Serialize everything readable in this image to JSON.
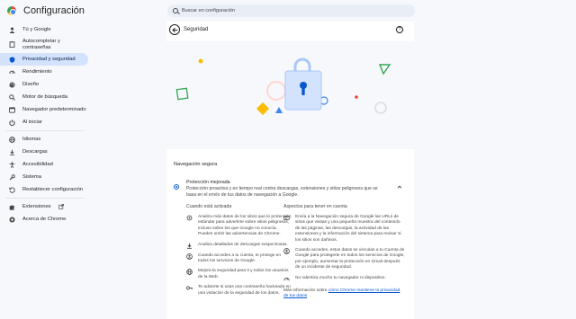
{
  "app": {
    "title": "Configuración"
  },
  "search": {
    "placeholder": "Buscar en configuración"
  },
  "sidebar": {
    "items": [
      {
        "label": "Tú y Google",
        "icon": "person-icon"
      },
      {
        "label": "Autocompletar y contraseñas",
        "icon": "clipboard-icon"
      },
      {
        "label": "Privacidad y seguridad",
        "icon": "shield-icon",
        "active": true
      },
      {
        "label": "Rendimiento",
        "icon": "speedometer-icon"
      },
      {
        "label": "Diseño",
        "icon": "palette-icon"
      },
      {
        "label": "Motor de búsqueda",
        "icon": "search-icon"
      },
      {
        "label": "Navegador predeterminado",
        "icon": "browser-icon"
      },
      {
        "label": "Al iniciar",
        "icon": "power-icon"
      },
      {
        "label": "Idiomas",
        "icon": "globe-icon"
      },
      {
        "label": "Descargas",
        "icon": "download-icon"
      },
      {
        "label": "Accesibilidad",
        "icon": "accessibility-icon"
      },
      {
        "label": "Sistema",
        "icon": "wrench-icon"
      },
      {
        "label": "Restablecer configuración",
        "icon": "reset-icon"
      },
      {
        "label": "Extensiones",
        "icon": "puzzle-icon"
      },
      {
        "label": "Acerca de Chrome",
        "icon": "chrome-icon"
      }
    ]
  },
  "page": {
    "title": "Seguridad",
    "section_title": "Navegación segura",
    "option": {
      "title": "Protección mejorada",
      "description": "Protección proactiva y en tiempo real contra descargas, extensiones y sitios peligrosos que se basa en el envío de tus datos de navegación a Google."
    },
    "when_on": {
      "heading": "Cuando está activada",
      "items": [
        {
          "icon": "gear-shield-icon",
          "text": "Analiza más datos de los sitios que le protección estándar para advertirte sobre sitios peligrosos, incluso sobre los que Google no conocía. Puedes omitir las advertencias de Chrome."
        },
        {
          "icon": "download-icon",
          "text": "Analiza detallados de descargas sospechosas."
        },
        {
          "icon": "account-icon",
          "text": "Cuando accedes a tu cuenta, te protege en todos los servicios de Google."
        },
        {
          "icon": "globe-icon",
          "text": "Mejora la seguridad para ti y todos los usuarios de la Web."
        },
        {
          "icon": "key-icon",
          "text": "Te advierte si usas una contraseña hackeada en una violación de la seguridad de los datos."
        }
      ]
    },
    "considerations": {
      "heading": "Aspectos para tener en cuenta",
      "items": [
        {
          "icon": "link-icon",
          "text": "Envía a la Navegación segura de Google las URLs de sitios que visitas y una pequeña muestra del contenido de las páginas, las descargas, la actividad de las extensiones y la información del sistema para revisar si los sitios son dañinos."
        },
        {
          "icon": "account-icon",
          "text": "Cuando accedes, estos datos se vinculan a tu Cuenta de Google para protegerte en todos los servicios de Google, por ejemplo, aumentar la protección en Gmail después de un incidente de seguridad."
        },
        {
          "icon": "speed-icon",
          "text": "No ralentiza mucho tu navegador ni dispositivo."
        }
      ],
      "more_info_prefix": "Más información sobre ",
      "more_info_link": "cómo Chrome mantiene la privacidad de tus datos"
    }
  },
  "colors": {
    "accent": "#0b57d0",
    "active_nav_bg": "#d3e3fd",
    "page_bg": "#f6f8fc",
    "card_bg": "#ffffff"
  }
}
